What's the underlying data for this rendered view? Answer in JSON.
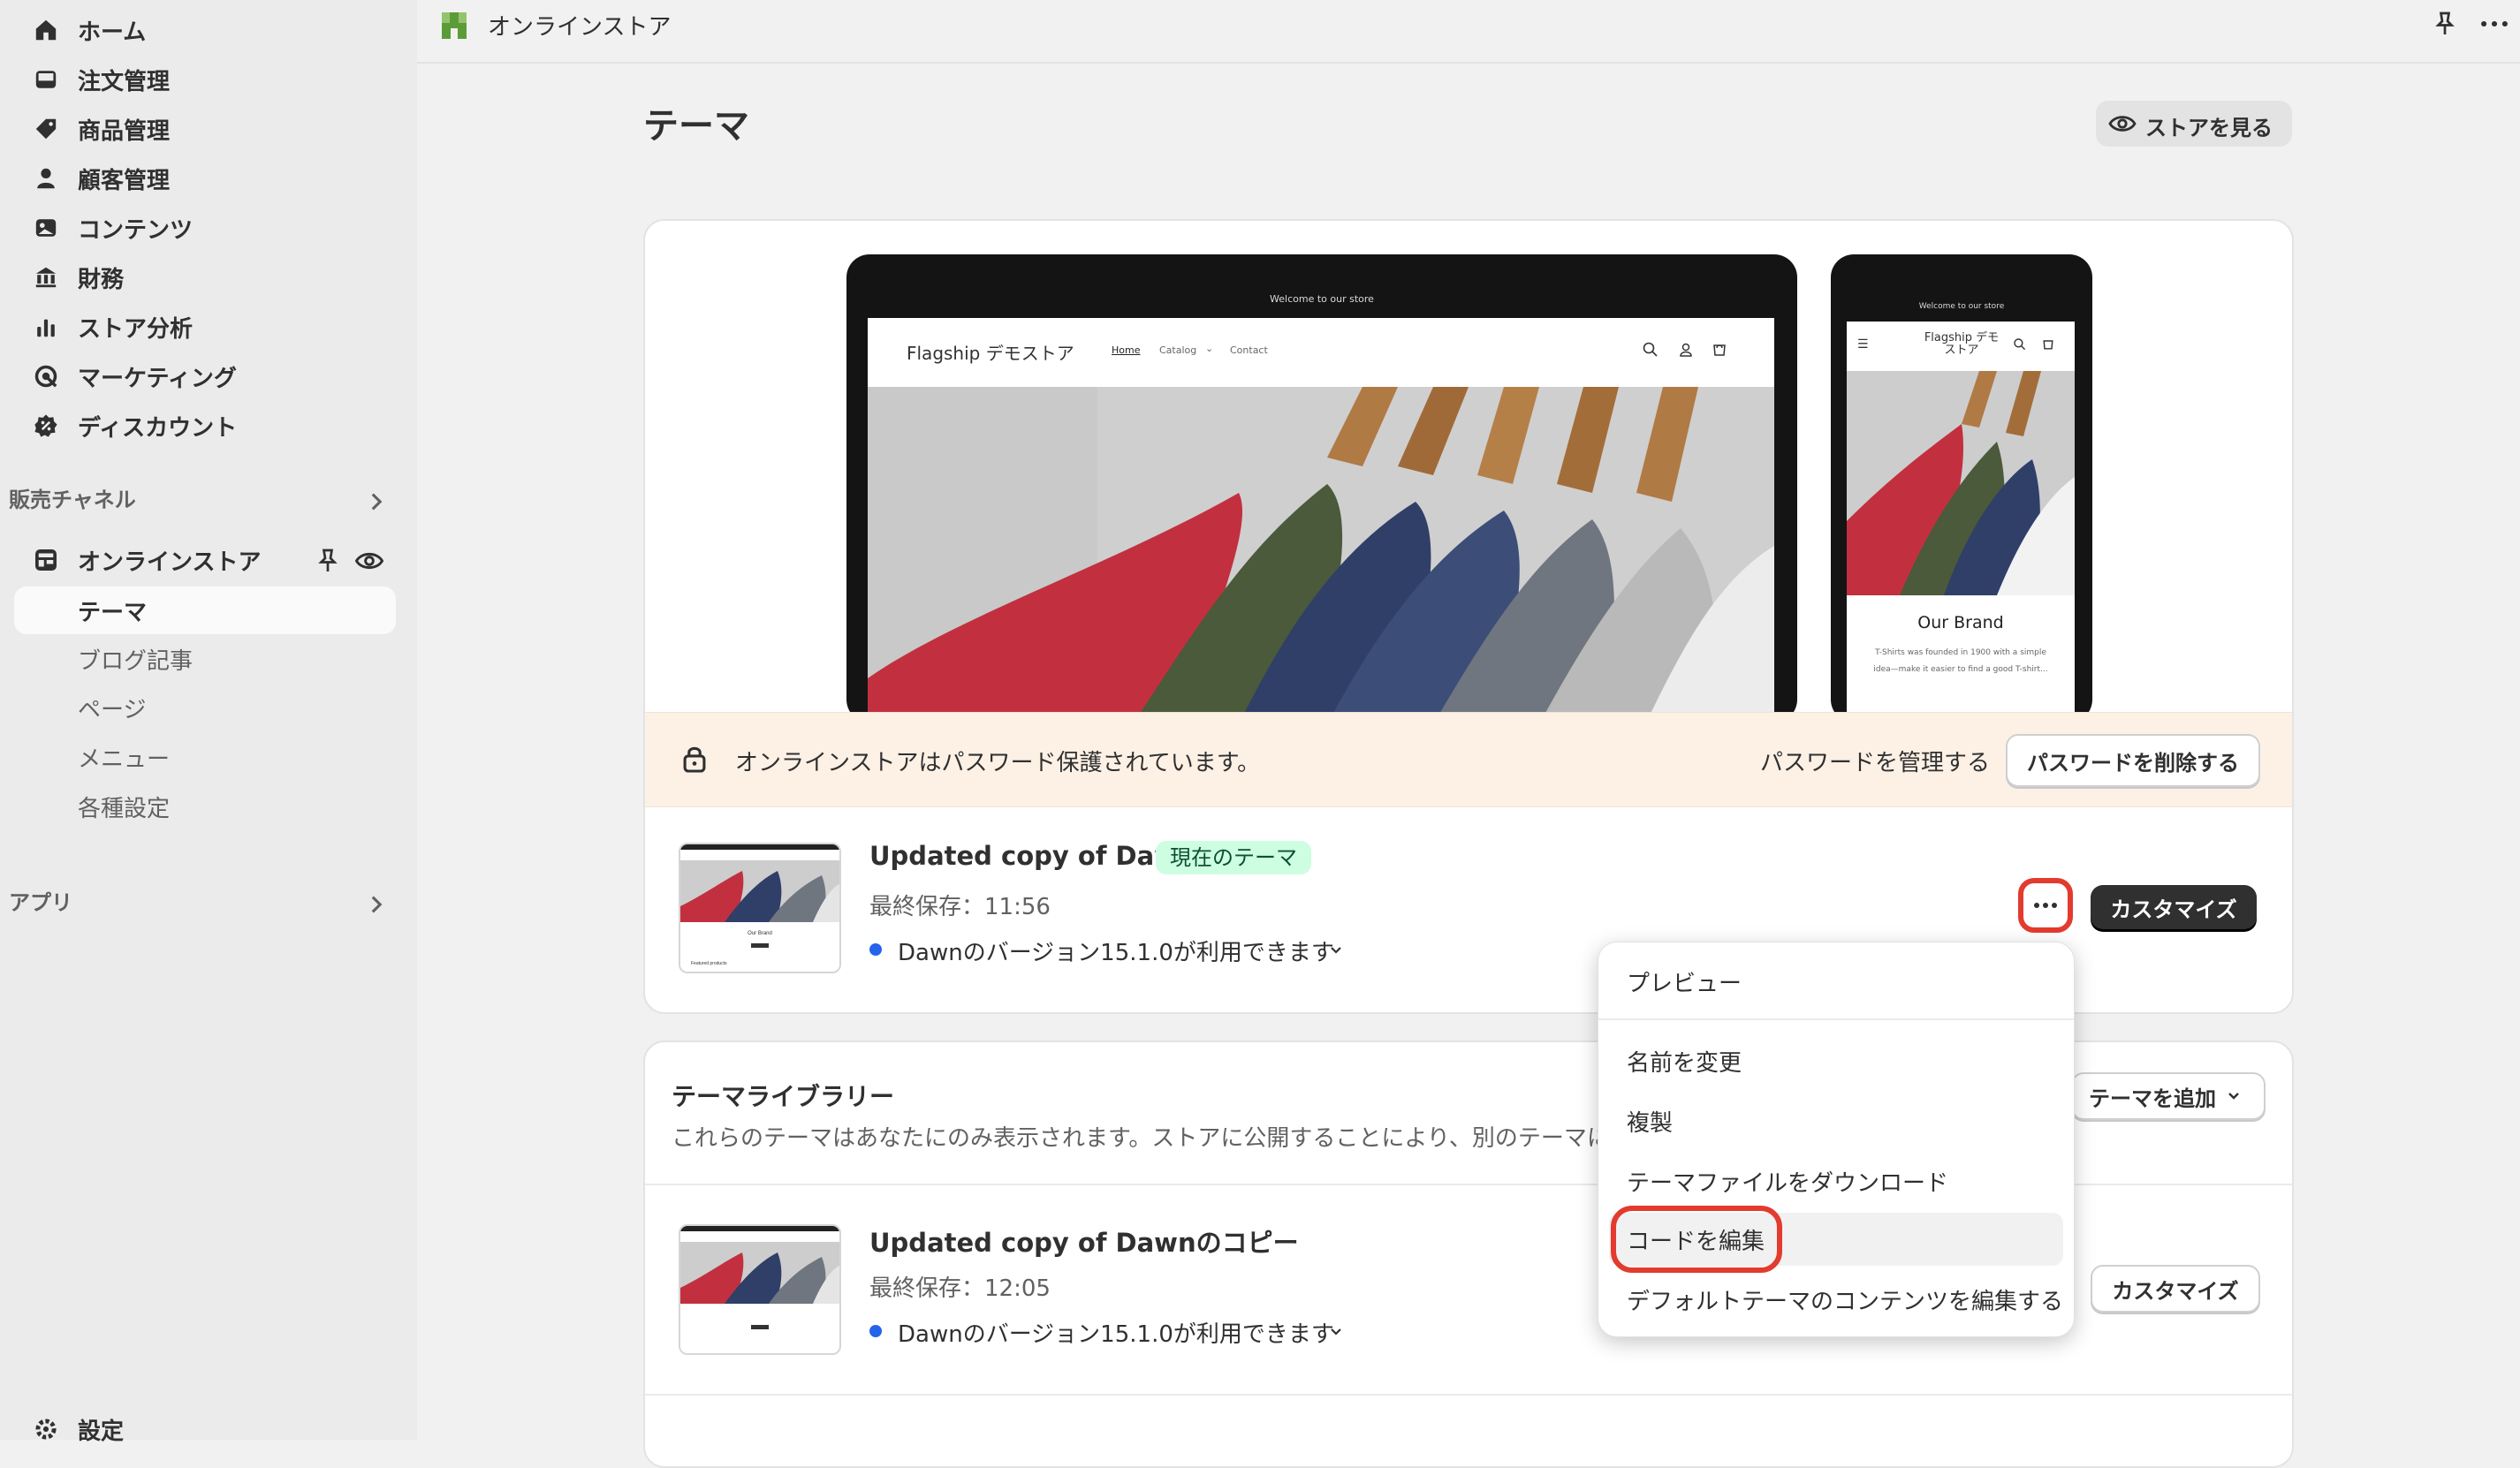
{
  "sidebar": {
    "items": [
      {
        "label": "ホーム",
        "icon": "home-icon"
      },
      {
        "label": "注文管理",
        "icon": "inbox-icon"
      },
      {
        "label": "商品管理",
        "icon": "tag-icon"
      },
      {
        "label": "顧客管理",
        "icon": "person-icon"
      },
      {
        "label": "コンテンツ",
        "icon": "image-icon"
      },
      {
        "label": "財務",
        "icon": "bank-icon"
      },
      {
        "label": "ストア分析",
        "icon": "bar-chart-icon"
      },
      {
        "label": "マーケティング",
        "icon": "target-icon"
      },
      {
        "label": "ディスカウント",
        "icon": "discount-icon"
      }
    ],
    "sales_channels_label": "販売チャネル",
    "online_store_label": "オンラインストア",
    "sub_items": [
      "テーマ",
      "ブログ記事",
      "ページ",
      "メニュー",
      "各種設定"
    ],
    "apps_label": "アプリ",
    "settings_label": "設定"
  },
  "topbar": {
    "title": "オンラインストア"
  },
  "page": {
    "title": "テーマ",
    "view_store_label": "ストアを見る"
  },
  "preview": {
    "announcement": "Welcome to our store",
    "store_name": "Flagship デモストア",
    "nav": [
      "Home",
      "Catalog",
      "Contact"
    ],
    "mobile_store_name": "Flagship デモ\nストア",
    "mobile_heading": "Our Brand",
    "mobile_text": "T-Shirts was founded in 1900 with a simple idea—make it easier to find a good T-shirt..."
  },
  "password_banner": {
    "text": "オンラインストアはパスワード保護されています。",
    "manage_label": "パスワードを管理する",
    "remove_label": "パスワードを削除する",
    "accent": "#fdf1e6"
  },
  "current_theme": {
    "name": "Updated copy of Dawn",
    "badge": "現在のテーマ",
    "saved": "最終保存：11:56",
    "update": "Dawnのバージョン15.1.0が利用できます",
    "customize_label": "カスタマイズ",
    "thumb_heading": "Our Brand",
    "thumb_text": "Featured products"
  },
  "library": {
    "title": "テーマライブラリー",
    "description": "これらのテーマはあなたにのみ表示されます。ストアに公開することにより、別のテーマに",
    "add_label": "テーマを追加",
    "themes": [
      {
        "name": "Updated copy of Dawnのコピー",
        "saved": "最終保存：12:05",
        "update": "Dawnのバージョン15.1.0が利用できます",
        "customize_label": "カスタマイズ"
      }
    ]
  },
  "dropdown_menu": {
    "items": [
      "プレビュー",
      "名前を変更",
      "複製",
      "テーマファイルをダウンロード",
      "コードを編集",
      "デフォルトテーマのコンテンツを編集する"
    ]
  },
  "colors": {
    "highlight": "#e33b2e",
    "badge_bg": "#cdfee1",
    "badge_text": "#0c5132",
    "dot": "#2463eb"
  }
}
